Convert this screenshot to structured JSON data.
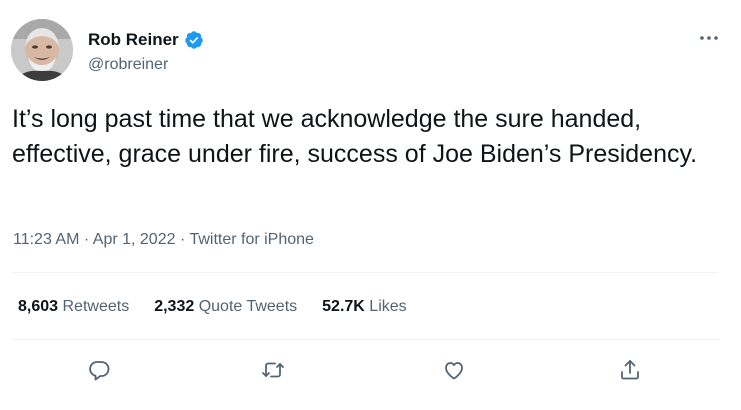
{
  "author": {
    "display_name": "Rob Reiner",
    "handle": "@robreiner"
  },
  "icons": {
    "verified": "verified-badge-icon",
    "more": "more-options-icon",
    "reply": "reply-icon",
    "retweet": "retweet-icon",
    "like": "like-icon",
    "share": "share-icon"
  },
  "tweet": {
    "text": "It’s long past time that we acknowledge the sure handed, effective, grace under fire, success of Joe Biden’s Presidency.",
    "time": "11:23 AM",
    "date": "Apr 1, 2022",
    "source": "Twitter for iPhone",
    "separator": " · "
  },
  "stats": {
    "retweets_count": "8,603",
    "retweets_label": "Retweets",
    "quotes_count": "2,332",
    "quotes_label": "Quote Tweets",
    "likes_count": "52.7K",
    "likes_label": "Likes"
  },
  "colors": {
    "accent": "#1d9bf0",
    "text_primary": "#0f1419",
    "text_secondary": "#536471",
    "divider": "#eff3f4"
  }
}
